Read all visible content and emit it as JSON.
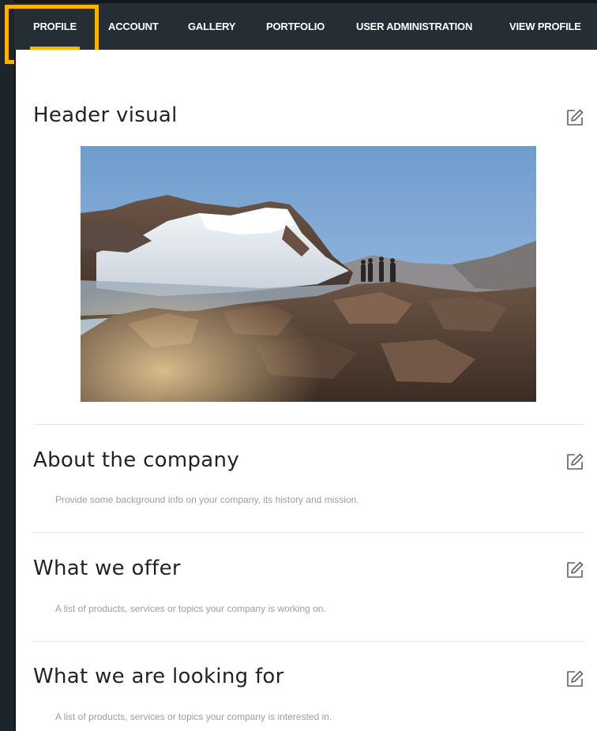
{
  "nav": {
    "tabs": [
      {
        "label": "PROFILE",
        "active": true
      },
      {
        "label": "ACCOUNT",
        "active": false
      },
      {
        "label": "GALLERY",
        "active": false
      },
      {
        "label": "PORTFOLIO",
        "active": false
      },
      {
        "label": "USER ADMINISTRATION",
        "active": false
      },
      {
        "label": "VIEW PROFILE",
        "active": false
      }
    ],
    "accent_color": "#f2b705",
    "highlight_color": "#f5b400"
  },
  "sections": [
    {
      "title": "Header visual",
      "icon": "edit-icon"
    },
    {
      "title": "About the company",
      "description": "Provide some background info on your company, its history and mission.",
      "icon": "edit-icon"
    },
    {
      "title": "What we offer",
      "description": "A list of products, services or topics your company is working on.",
      "icon": "edit-icon"
    },
    {
      "title": "What we are looking for",
      "description": "A list of products, services or topics your company is interested in.",
      "icon": "edit-icon"
    }
  ]
}
